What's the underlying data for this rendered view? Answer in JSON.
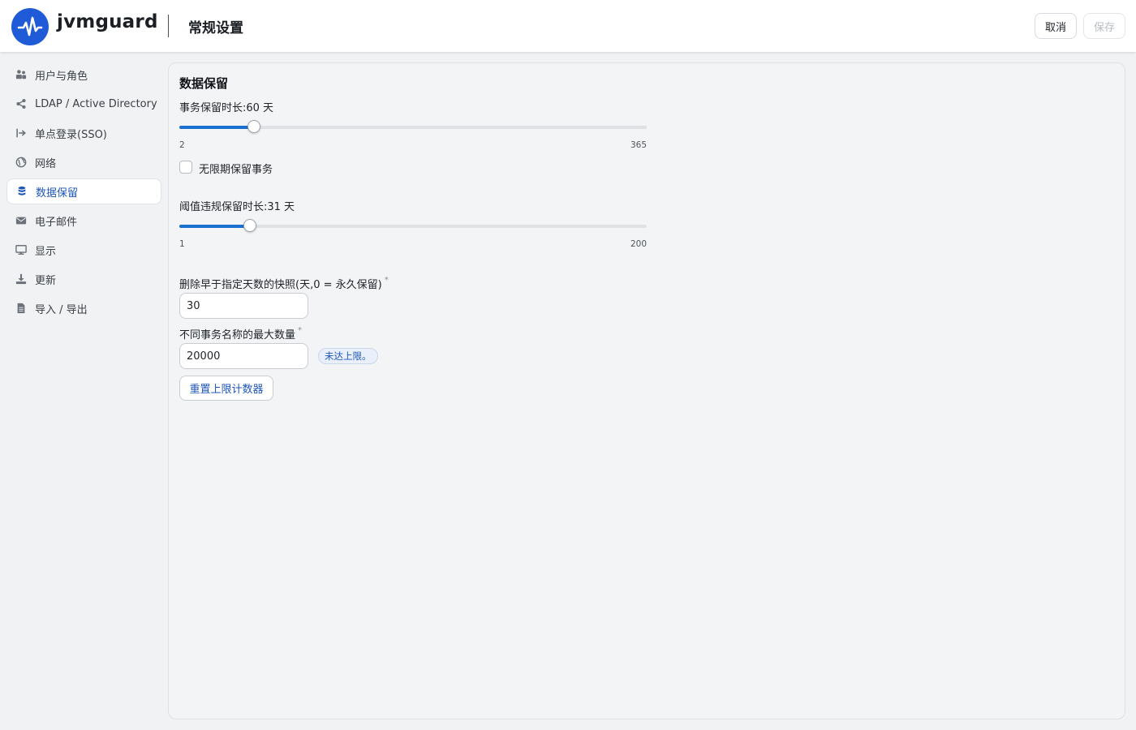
{
  "header": {
    "brand": "jvmguard",
    "page_title": "常规设置",
    "cancel_label": "取消",
    "save_label": "保存"
  },
  "sidebar": {
    "items": [
      {
        "label": "用户与角色",
        "icon": "users-icon",
        "active": false
      },
      {
        "label": "LDAP / Active Directory",
        "icon": "share-icon",
        "active": false
      },
      {
        "label": "单点登录(SSO)",
        "icon": "sign-in-icon",
        "active": false
      },
      {
        "label": "网络",
        "icon": "globe-icon",
        "active": false
      },
      {
        "label": "数据保留",
        "icon": "database-icon",
        "active": true
      },
      {
        "label": "电子邮件",
        "icon": "envelope-icon",
        "active": false
      },
      {
        "label": "显示",
        "icon": "monitor-icon",
        "active": false
      },
      {
        "label": "更新",
        "icon": "download-icon",
        "active": false
      },
      {
        "label": "导入 / 导出",
        "icon": "file-icon",
        "active": false
      }
    ]
  },
  "main": {
    "section_title": "数据保留",
    "transaction_retention": {
      "label": "事务保留时长:60 天",
      "value": 60,
      "min": 2,
      "max": 365,
      "min_label": "2",
      "max_label": "365"
    },
    "unlimited_checkbox": {
      "label": "无限期保留事务",
      "checked": false
    },
    "violation_retention": {
      "label": "阈值违规保留时长:31 天",
      "value": 31,
      "min": 1,
      "max": 200,
      "min_label": "1",
      "max_label": "200"
    },
    "snapshot_field": {
      "label": "删除早于指定天数的快照(天,0 = 永久保留)",
      "required_mark": "*",
      "value": "30"
    },
    "max_names_field": {
      "label": "不同事务名称的最大数量",
      "required_mark": "*",
      "value": "20000",
      "status_badge": "未达上限。"
    },
    "reset_button_label": "重置上限计数器"
  },
  "colors": {
    "accent": "#1a6fd0",
    "brand": "#1f5bd6",
    "active_text": "#1e56b8"
  }
}
